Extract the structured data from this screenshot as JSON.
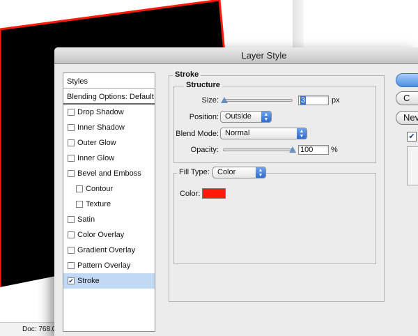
{
  "dialog": {
    "title": "Layer Style"
  },
  "canvas": {
    "doc_status": "Doc: 768.0"
  },
  "styles_panel": {
    "header": "Styles",
    "blending": "Blending Options: Default",
    "items": [
      {
        "label": "Drop Shadow",
        "checked": false,
        "indent": false,
        "selected": false
      },
      {
        "label": "Inner Shadow",
        "checked": false,
        "indent": false,
        "selected": false
      },
      {
        "label": "Outer Glow",
        "checked": false,
        "indent": false,
        "selected": false
      },
      {
        "label": "Inner Glow",
        "checked": false,
        "indent": false,
        "selected": false
      },
      {
        "label": "Bevel and Emboss",
        "checked": false,
        "indent": false,
        "selected": false
      },
      {
        "label": "Contour",
        "checked": false,
        "indent": true,
        "selected": false
      },
      {
        "label": "Texture",
        "checked": false,
        "indent": true,
        "selected": false
      },
      {
        "label": "Satin",
        "checked": false,
        "indent": false,
        "selected": false
      },
      {
        "label": "Color Overlay",
        "checked": false,
        "indent": false,
        "selected": false
      },
      {
        "label": "Gradient Overlay",
        "checked": false,
        "indent": false,
        "selected": false
      },
      {
        "label": "Pattern Overlay",
        "checked": false,
        "indent": false,
        "selected": false
      },
      {
        "label": "Stroke",
        "checked": true,
        "indent": false,
        "selected": true
      }
    ]
  },
  "stroke": {
    "title": "Stroke",
    "structure": {
      "title": "Structure",
      "size_label": "Size:",
      "size_value": "3",
      "size_unit": "px",
      "size_fraction": 0.02,
      "position_label": "Position:",
      "position_value": "Outside",
      "blend_label": "Blend Mode:",
      "blend_value": "Normal",
      "opacity_label": "Opacity:",
      "opacity_value": "100",
      "opacity_unit": "%",
      "opacity_fraction": 1.0
    },
    "fill": {
      "type_label": "Fill Type:",
      "type_value": "Color",
      "color_label": "Color:",
      "color_hex": "#ff1a0a"
    }
  },
  "buttons": {
    "ok_label": "",
    "cancel_label": "C",
    "new_style_label": "Nev",
    "preview_checked": true
  },
  "colors": {
    "selection": "#c2d9f6",
    "accent_blue": "#3f7fe0",
    "canvas_stroke": "#ff1a0a"
  }
}
